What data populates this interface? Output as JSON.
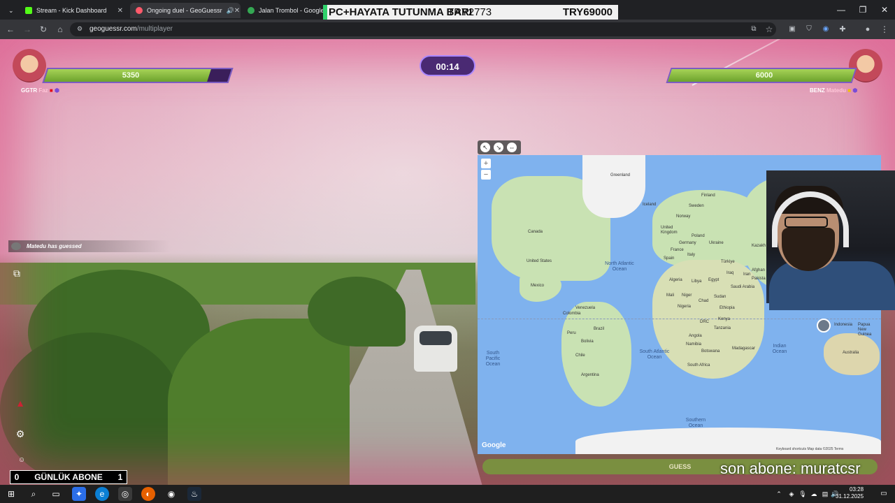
{
  "browser": {
    "tabs": [
      {
        "title": "Stream - Kick Dashboard",
        "active": false
      },
      {
        "title": "Ongoing duel - GeoGuessr",
        "active": true
      },
      {
        "title": "Jalan Trombol - Google Ha",
        "active": false
      }
    ],
    "overlay_banner": {
      "left_text": "PC+HAYATA TUTUNMA BARI",
      "middle_text": "TRY2773",
      "right_text": "TRY69000"
    },
    "url": {
      "host": "geoguessr.com",
      "path": "/multiplayer"
    },
    "window_controls": {
      "minimize": "—",
      "restore": "❐",
      "close": "✕"
    },
    "nav": {
      "back": "←",
      "forward": "→",
      "reload": "↻",
      "home": "⌂"
    }
  },
  "game": {
    "timer": "00:14",
    "player_left": {
      "score": "5350",
      "health_fraction": 0.89,
      "tag": "GGTR",
      "name": "Faz"
    },
    "player_right": {
      "score": "6000",
      "health_fraction": 1.0,
      "tag": "BENZ",
      "name": "Matedu"
    },
    "notice": "Matedu has guessed",
    "guess_button": "GUESS",
    "colors": {
      "health": "#8cc43e",
      "timer_bg": "#4a2a73",
      "accent": "#a986ff"
    }
  },
  "map": {
    "labels": {
      "greenland": "Greenland",
      "iceland": "Iceland",
      "finland": "Finland",
      "sweden": "Sweden",
      "norway": "Norway",
      "uk": "United Kingdom",
      "poland": "Poland",
      "germany": "Germany",
      "ukraine": "Ukraine",
      "france": "France",
      "spain": "Spain",
      "italy": "Italy",
      "turkiye": "Türkiye",
      "iraq": "Iraq",
      "iran": "Iran",
      "kazakh": "Kazakh",
      "afghan": "Afghan",
      "pakistan": "Pakista",
      "algeria": "Algeria",
      "libya": "Libya",
      "egypt": "Egypt",
      "saudi": "Saudi Arabia",
      "mali": "Mali",
      "niger": "Niger",
      "chad": "Chad",
      "sudan": "Sudan",
      "nigeria": "Nigeria",
      "ethiopia": "Ethiopia",
      "kenya": "Kenya",
      "drc": "DRC",
      "tanzania": "Tanzania",
      "angola": "Angola",
      "namibia": "Namibia",
      "botswana": "Botswana",
      "madagascar": "Madagascar",
      "south_africa": "South Africa",
      "canada": "Canada",
      "usa": "United States",
      "mexico": "Mexico",
      "venezuela": "Venezuela",
      "colombia": "Colombia",
      "peru": "Peru",
      "brazil": "Brazil",
      "bolivia": "Bolivia",
      "chile": "Chile",
      "argentina": "Argentina",
      "indonesia": "Indonesia",
      "papua": "Papua New Guinea",
      "australia": "Australia"
    },
    "oceans": {
      "north_atlantic": "North Atlantic Ocean",
      "south_atlantic": "South Atlantic Ocean",
      "south_pacific": "South Pacific Ocean",
      "indian": "Indian Ocean",
      "southern": "Southern Ocean"
    },
    "google": "Google",
    "footer": "Keyboard shortcuts   Map data ©2025   Terms",
    "zoom_in": "+",
    "zoom_out": "−"
  },
  "stream": {
    "sub_counter": {
      "left": "0",
      "label": "GÜNLÜK ABONE",
      "right": "1"
    },
    "last_sub": "son abone: muratcsr"
  },
  "taskbar": {
    "time": "03:28",
    "date": "31.12.2025"
  }
}
